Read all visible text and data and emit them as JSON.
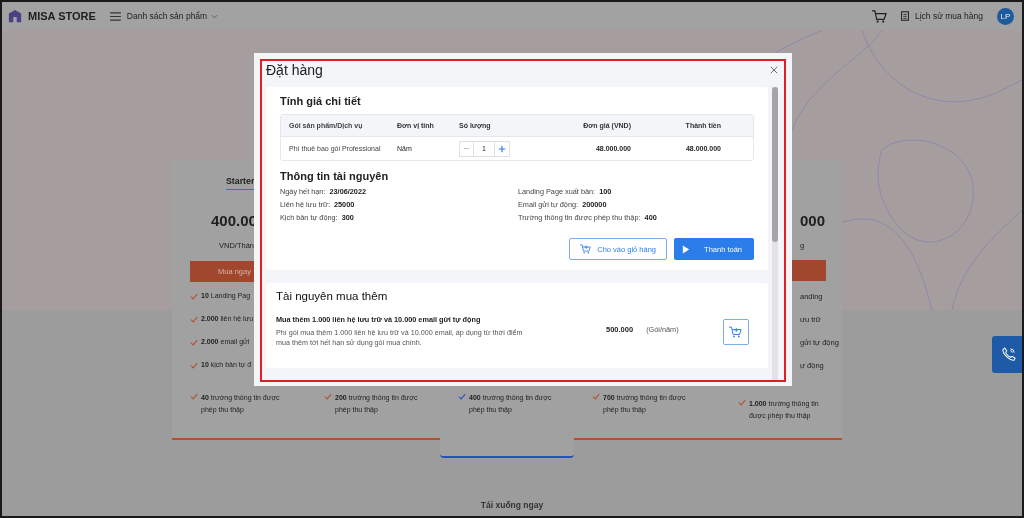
{
  "header": {
    "logo": "MISA STORE",
    "menu": "Danh sách sản phẩm",
    "history": "Lịch sử mua hàng",
    "avatar": "LP"
  },
  "plans": [
    {
      "name": "Starter",
      "price": "400.00",
      "unit": "VND/Thán",
      "button": "Mua ngay",
      "features": [
        {
          "bold": "10",
          "text": "Landing Pag"
        },
        {
          "bold": "2.000",
          "text": "liên hệ lưu"
        },
        {
          "bold": "2.000",
          "text": "email gửi"
        },
        {
          "bold": "10",
          "text": "kịch bản tự đ"
        }
      ],
      "last_feature": {
        "bold": "40",
        "text": "trường thông tin được phép thu thập"
      },
      "highlighted": false
    },
    {
      "last_feature": {
        "bold": "200",
        "text": "trường thông tin được phép thu thập"
      },
      "highlighted": false
    },
    {
      "last_feature": {
        "bold": "400",
        "text": "trường thông tin được phép thu thập"
      },
      "highlighted": true
    },
    {
      "last_feature": {
        "bold": "700",
        "text": "trường thông tin được phép thu thập"
      },
      "highlighted": false
    },
    {
      "price": "000",
      "unit": "g",
      "button_shown": true,
      "features": [
        {
          "text": "anding"
        },
        {
          "text": "ưu trữ"
        },
        {
          "text": "gửi tự động"
        },
        {
          "text": "ự động"
        }
      ],
      "last_feature": {
        "bold": "1.000",
        "text": "trường thông tin được phép thu thập"
      },
      "highlighted": false
    }
  ],
  "download": "Tải xuống ngay",
  "modal": {
    "title": "Đặt hàng",
    "pricing": {
      "title": "Tính giá chi tiết",
      "columns": [
        "Gói sản phẩm/Dịch vụ",
        "Đơn vị tính",
        "Số lượng",
        "Đơn giá (VND)",
        "Thành tiền"
      ],
      "row": {
        "product": "Phí thuê bao gói Professional",
        "unit": "Năm",
        "quantity": "1",
        "price": "48.000.000",
        "total": "48.000.000"
      }
    },
    "resources": {
      "title": "Thông tin tài nguyên",
      "items": [
        {
          "label": "Ngày hết hạn:",
          "value": "23/06/2022"
        },
        {
          "label": "Landing Page xuất bản:",
          "value": "100"
        },
        {
          "label": "Liên hệ lưu trữ:",
          "value": "25000"
        },
        {
          "label": "Email gửi tự động:",
          "value": "200000"
        },
        {
          "label": "Kịch bản tự động:",
          "value": "300"
        },
        {
          "label": "Trường thông tin được phép thu thập:",
          "value": "400"
        }
      ]
    },
    "add_to_cart": "Cho vào giỏ hàng",
    "checkout": "Thanh toán",
    "extras": {
      "title": "Tài nguyên mua thêm",
      "item": {
        "title": "Mua thêm 1.000 liên hệ lưu trữ và 10.000 email gửi tự động",
        "description": "Phí gói mua thêm 1.000 liên hệ lưu trữ và 10.000 email, áp dụng từ thời điểm mua thêm tới hết hạn sử dụng gói mua chính.",
        "price": "500.000",
        "unit": "(Gói/năm)"
      }
    }
  }
}
